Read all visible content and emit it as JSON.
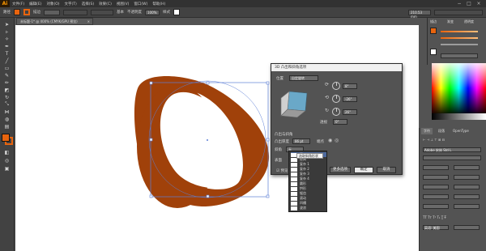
{
  "app": {
    "logo": "Ai"
  },
  "menubar": {
    "items": [
      "文件(F)",
      "编辑(E)",
      "对象(O)",
      "文字(T)",
      "选择(S)",
      "效果(C)",
      "视图(V)",
      "窗口(W)",
      "帮助(H)"
    ],
    "right_icons": [
      "minimize-icon",
      "maximize-icon",
      "close-icon"
    ]
  },
  "controlbar": {
    "label_path": "路径",
    "stroke_label": "描边",
    "stroke_value": "",
    "style_label": "基本",
    "opacity_label": "不透明度",
    "opacity_value": "100%",
    "style2_label": "样式",
    "width_value": "210.53 mm",
    "colors": {
      "fill": "#e8640e",
      "stroke": "#e8640e"
    }
  },
  "document": {
    "tab_label": "未标题-1* @ 400% (CMYK/GPU 预览)",
    "close_symbol": "×"
  },
  "artwork": {
    "ring_color": "#a0410a",
    "hole_color": "#ffffff",
    "selection_color": "#5d7fd6"
  },
  "dialog3d": {
    "title": "3D 凸出和斜角选项",
    "position_label": "位置",
    "position_value": "自定旋转",
    "rot_x": "8°",
    "rot_y": "-26°",
    "rot_z": "26°",
    "perspective_label": "透视",
    "perspective_value": "0°",
    "extrude_section": "凸出与斜角",
    "extrude_depth_label": "凸出厚度",
    "extrude_depth_value": "86 pt",
    "cap_label": "端点",
    "bevel_label": "斜角",
    "bevel_value": "无",
    "surface_label": "表面",
    "preview_label": "预览",
    "map_button": "贴图",
    "more_button": "更多选项",
    "ok_button": "确定",
    "cancel_button": "取消",
    "cube_front": "#6aa8c8",
    "cube_side": "#d0d0d0"
  },
  "bevel_list": {
    "items": [
      "无",
      "经典",
      "复杂 1",
      "复杂 2",
      "复杂 3",
      "复杂 4",
      "圆形",
      "拱形",
      "锯齿",
      "滚动",
      "凹槽",
      "波浪"
    ],
    "selected_index": 0
  },
  "tooltip": {
    "text": "选取斜角形状"
  },
  "right_panel_top": {
    "labels": [
      "描边",
      "渐变",
      "透明度"
    ],
    "slider_values": [
      "",
      "",
      ""
    ]
  },
  "right_panel_char": {
    "tabs": [
      "字符",
      "段落",
      "OpenType"
    ],
    "font_value": "Adobe 宋体 Std L",
    "lang_value": "英语: 美国"
  }
}
